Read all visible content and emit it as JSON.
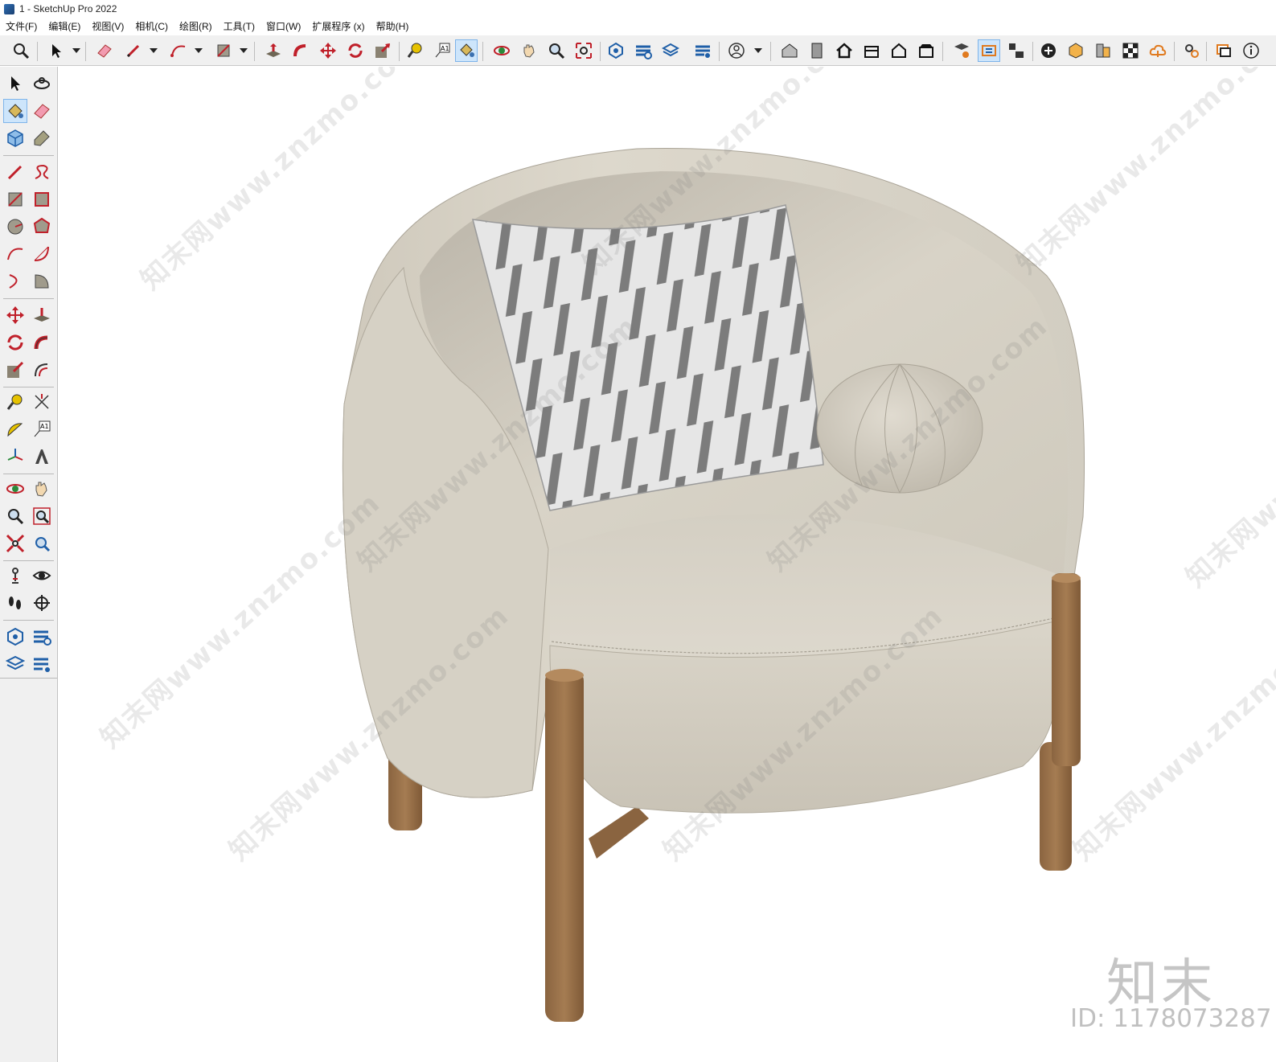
{
  "window": {
    "title": "1 - SketchUp Pro 2022"
  },
  "menu": {
    "items": [
      "文件(F)",
      "编辑(E)",
      "视图(V)",
      "相机(C)",
      "绘图(R)",
      "工具(T)",
      "窗口(W)",
      "扩展程序 (x)",
      "帮助(H)"
    ]
  },
  "toolbar": {
    "icons": [
      "zoom-icon",
      "select-icon",
      "eraser-icon",
      "pencil-line-icon",
      "arc-icon",
      "rectangle-icon",
      "push-pull-icon",
      "follow-me-icon",
      "move-icon",
      "rotate-icon",
      "scale-icon",
      "tape-measure-icon",
      "text-icon",
      "paint-bucket-icon",
      "orbit-icon",
      "pan-icon",
      "zoom-window-icon",
      "zoom-extents-icon",
      "warehouse-icon",
      "extension-warehouse-icon",
      "layout-icon",
      "extension-manager-icon",
      "profile-icon",
      "house-front-icon",
      "door-icon",
      "home-icon",
      "house-top-icon",
      "house-outline-icon",
      "house-side-icon",
      "model-info-icon",
      "scenes-icon",
      "camera-icon",
      "add-location-icon",
      "section-plane-icon",
      "styles-icon",
      "shadows-icon",
      "cloud-icon",
      "preferences-icon",
      "messages-icon",
      "info-icon"
    ],
    "active_tool": "paint-bucket-icon"
  },
  "left_toolbar": {
    "icons": [
      "select-icon",
      "orbit-icon",
      "paint-bucket-icon",
      "eraser-icon",
      "component-icon",
      "tag-icon",
      "line-icon",
      "freehand-icon",
      "rectangle-icon",
      "rotated-rectangle-icon",
      "circle-icon",
      "polygon-icon",
      "arc-icon",
      "two-point-arc-icon",
      "three-point-arc-icon",
      "pie-icon",
      "move-icon",
      "push-pull-icon",
      "rotate-icon",
      "follow-me-icon",
      "scale-icon",
      "offset-icon",
      "tape-measure-icon",
      "dimension-icon",
      "protractor-icon",
      "text-icon",
      "axes-icon",
      "3d-text-icon",
      "orbit-icon",
      "pan-icon",
      "zoom-icon",
      "zoom-window-icon",
      "zoom-extents-icon",
      "previous-view-icon",
      "position-camera-icon",
      "look-around-icon",
      "walk-icon",
      "section-plane-icon",
      "warehouse-icon",
      "extension-warehouse-icon",
      "layout-icon",
      "extension-manager-icon"
    ],
    "active_tool": "paint-bucket-icon"
  },
  "viewport": {
    "model": "armchair",
    "colors": {
      "fabric": "#d9d4c8",
      "fabric_shadow": "#b8b2a6",
      "wood": "#9a7248",
      "wood_dark": "#7a5634",
      "pillow_light": "#e8e8e8",
      "pillow_dark": "#777777"
    },
    "watermarks": [
      "知末网www.znzmo.com"
    ],
    "brand": "知末",
    "asset_id": "ID: 1178073287"
  }
}
